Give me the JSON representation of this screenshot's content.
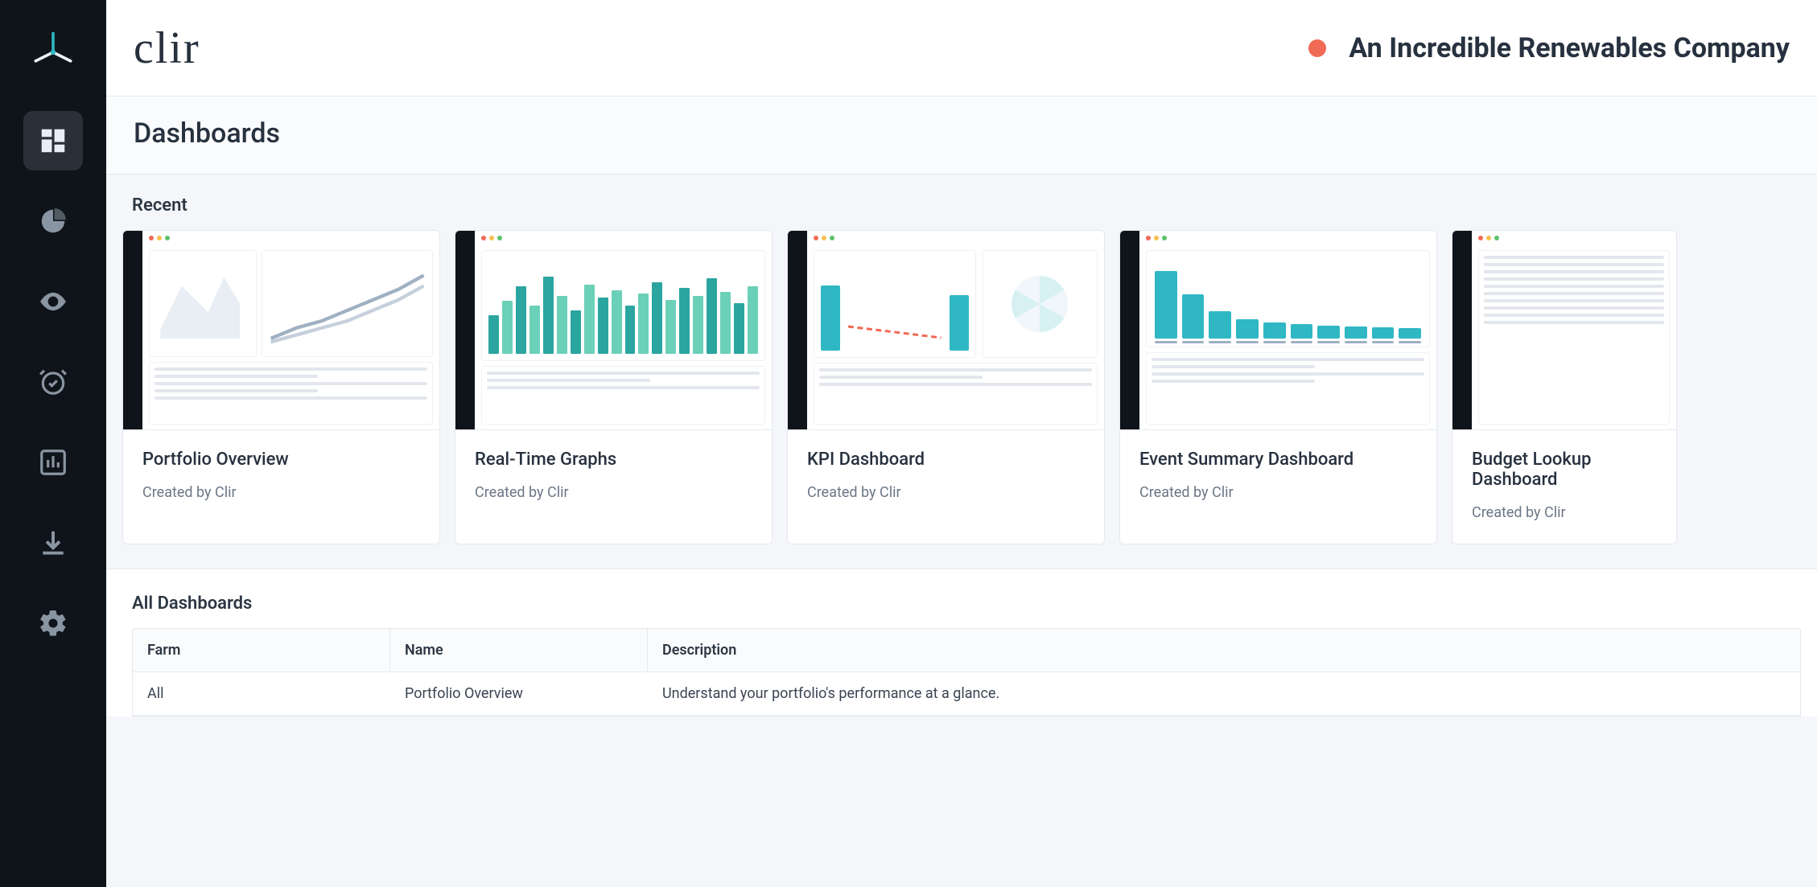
{
  "brand": "clir",
  "organization": "An Incredible Renewables Company",
  "status_color": "#f06a55",
  "page_title": "Dashboards",
  "sidebar": {
    "items": [
      {
        "name": "dashboards",
        "icon": "grid-icon",
        "active": true
      },
      {
        "name": "analytics",
        "icon": "donut-icon",
        "active": false
      },
      {
        "name": "monitor",
        "icon": "eye-icon",
        "active": false
      },
      {
        "name": "alarms",
        "icon": "alarm-check-icon",
        "active": false
      },
      {
        "name": "reports",
        "icon": "bar-chart-icon",
        "active": false
      },
      {
        "name": "downloads",
        "icon": "download-icon",
        "active": false
      },
      {
        "name": "settings",
        "icon": "gear-icon",
        "active": false
      }
    ]
  },
  "recent": {
    "title": "Recent",
    "cards": [
      {
        "title": "Portfolio Overview",
        "meta": "Created by Clir"
      },
      {
        "title": "Real-Time Graphs",
        "meta": "Created by Clir"
      },
      {
        "title": "KPI Dashboard",
        "meta": "Created by Clir"
      },
      {
        "title": "Event Summary Dashboard",
        "meta": "Created by Clir"
      },
      {
        "title": "Budget Lookup Dashboard",
        "meta": "Created by Clir"
      }
    ]
  },
  "all": {
    "title": "All Dashboards",
    "columns": [
      "Farm",
      "Name",
      "Description"
    ],
    "rows": [
      {
        "farm": "All",
        "name": "Portfolio Overview",
        "description": "Understand your portfolio's performance at a glance."
      }
    ]
  }
}
